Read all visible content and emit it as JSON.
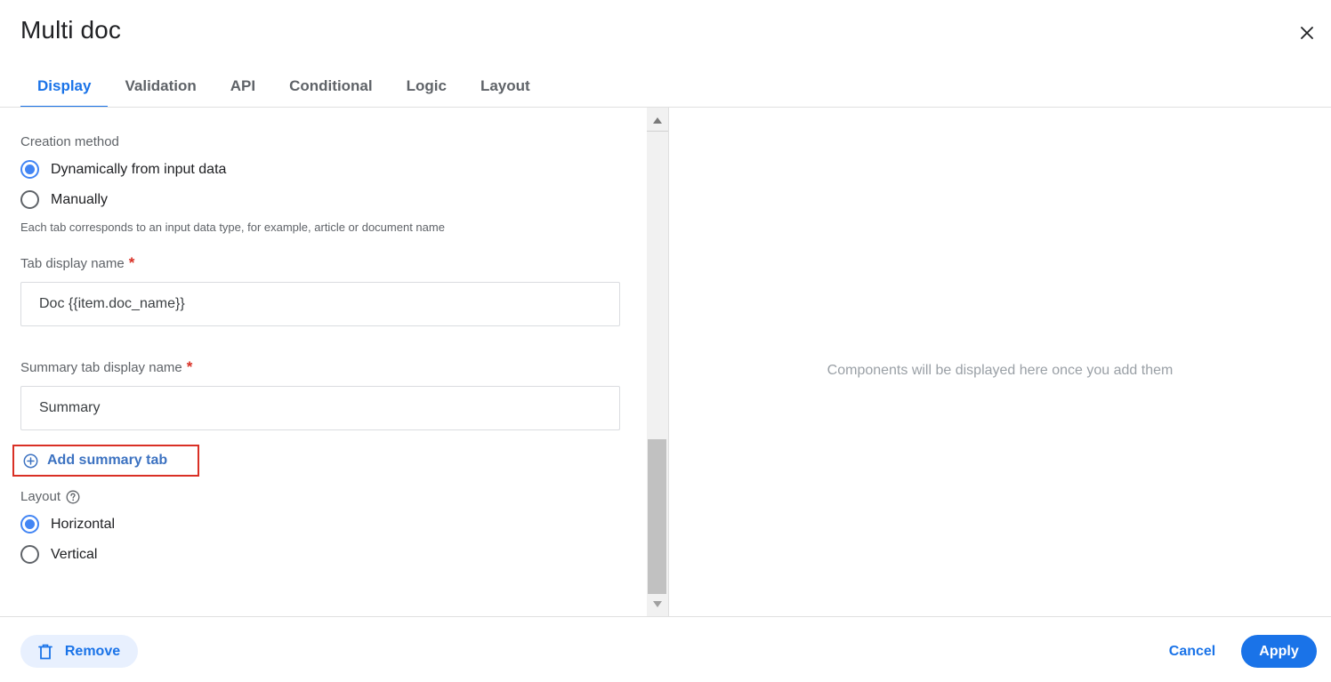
{
  "dialog": {
    "title": "Multi doc"
  },
  "tabs": [
    {
      "label": "Display",
      "active": true
    },
    {
      "label": "Validation",
      "active": false
    },
    {
      "label": "API",
      "active": false
    },
    {
      "label": "Conditional",
      "active": false
    },
    {
      "label": "Logic",
      "active": false
    },
    {
      "label": "Layout",
      "active": false
    }
  ],
  "form": {
    "creation_method": {
      "label": "Creation method",
      "options": [
        {
          "label": "Dynamically from input data",
          "checked": true
        },
        {
          "label": "Manually",
          "checked": false
        }
      ],
      "helper": "Each tab corresponds to an input data type, for example, article or document name"
    },
    "tab_display_name": {
      "label": "Tab display name",
      "required_mark": "*",
      "value": "Doc {{item.doc_name}}"
    },
    "summary_tab_display_name": {
      "label": "Summary tab display name",
      "required_mark": "*",
      "value": "Summary"
    },
    "add_summary_tab": {
      "label": "Add summary tab",
      "icon": "plus-circle-icon"
    },
    "layout": {
      "label": "Layout",
      "icon": "help-icon",
      "options": [
        {
          "label": "Horizontal",
          "checked": true
        },
        {
          "label": "Vertical",
          "checked": false
        }
      ]
    }
  },
  "preview": {
    "empty_message": "Components will be displayed here once you add them"
  },
  "footer": {
    "remove_label": "Remove",
    "cancel_label": "Cancel",
    "apply_label": "Apply"
  },
  "colors": {
    "accent": "#1a73e8",
    "radio_checked": "#4285f4",
    "required": "#d93025",
    "highlight_border": "#d93025"
  }
}
